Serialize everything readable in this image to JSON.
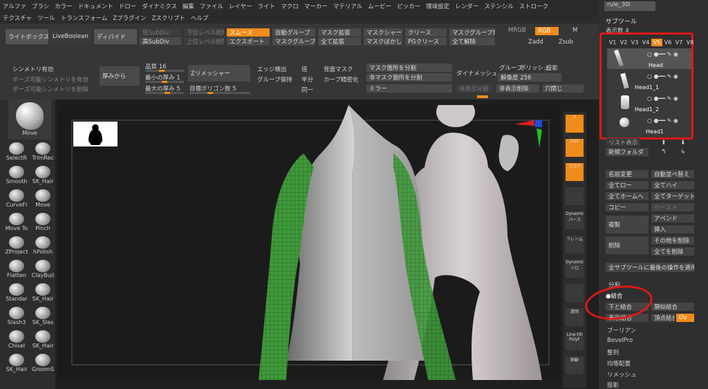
{
  "menu": [
    "アルファ",
    "ブラシ",
    "カラー",
    "ドキュメント",
    "ドロー",
    "ダイナミクス",
    "編集",
    "ファイル",
    "レイヤー",
    "ライト",
    "マクロ",
    "マーカー",
    "マテリアル",
    "ムービー",
    "ピッカー",
    "環境設定",
    "レンダー",
    "ステンシル",
    "ストローク"
  ],
  "menu2": [
    "テクスチャ",
    "ツール",
    "トランスフォーム",
    "Zプラグイン",
    "Zスクリプト",
    "ヘルプ"
  ],
  "palette": {
    "lightbox": "ライトボックス",
    "liveboolean": "LiveBoolean",
    "divide": "ディバイド",
    "delsubdiv": "低SubDiv",
    "highsubdiv": "高SubDiv",
    "lower_level": "下位レベル削除",
    "upper_level": "上位レベル削除",
    "smooth": "スムーズ",
    "export": "エクスポート",
    "auto_group": "自動グループ",
    "mask_group": "マスクグループ化",
    "mask_expand": "マスク拡張",
    "all_expand": "全て拡張",
    "mask_sharpen": "マスクシャープン",
    "mask_blur": "マスクぼかし",
    "crease": "クリース",
    "pgcrease": "PGクリース",
    "mask_group2": "マスクグループ化",
    "all_release": "全て解除",
    "mrgb": "MRGB",
    "rgb": "RGB",
    "m": "M",
    "zadd": "Zadd",
    "zsub": "Zsub",
    "symmetry": "シンメトリ有効",
    "pose_sym1": "ポーズ可能シンメトリを有効",
    "pose_sym2": "ポーズ可能シンメトリを削除",
    "thickness": "厚みから",
    "quality": "品質 16",
    "min_thick": "最小の厚み 1",
    "max_thick": "最大の厚み 5",
    "zremesher": "Zリメッシャー",
    "target_poly": "目標ポリゴン数 5",
    "edge_detect": "エッジ検出",
    "group_keep": "グループ保持",
    "double": "倍",
    "half": "半分",
    "same": "同一",
    "backface_mask": "背面マスク",
    "curve_refine": "カーブ精密化",
    "mask_split": "マスク箇所を分割",
    "unmask_split": "非マスク箇所を分割",
    "mirror": "ミラー",
    "dynamesh": "ダイナメッシュ",
    "group": "グループ",
    "polish": "ポリッシュ",
    "project": "投影",
    "resolution": "解像度 256",
    "hidden_split": "非表示分割",
    "hidden_delete": "非表示削除",
    "close_holes": "穴閉じ"
  },
  "brushes": {
    "main": "Move",
    "items": [
      "SelectR",
      "TrimRec",
      "Smooth",
      "SK_Hair",
      "CurveFl",
      "Move",
      "Move To",
      "Pinch",
      "ZProject",
      "hPolish",
      "Flatten",
      "ClayBuil",
      "Standar",
      "SK_Hair",
      "Slash3",
      "SK_Slas",
      "Chisel",
      "SK_Hair",
      "SK_Hair",
      "GroomS"
    ]
  },
  "right_shelf": [
    "S",
    "Edit",
    "ブロア",
    "",
    "Dynamic パース",
    "フレーム",
    "Dynamic ソロ",
    "",
    "透明",
    "Line Fill PolyF",
    "移動"
  ],
  "rightpanel": {
    "field": "rule_30i",
    "title": "サブツール",
    "display_count": "表示数 4",
    "versions": [
      "V1",
      "V2",
      "V3",
      "V4",
      "V5",
      "V6",
      "V7",
      "V8"
    ],
    "active_version": "V5",
    "subtools": [
      "Head",
      "Head1_1",
      "Head1_2",
      "Head1"
    ],
    "list_display": "リスト表示",
    "new_folder": "新規フォルダ",
    "rename": "名前変更",
    "auto_rename": "自動並べ替え",
    "all_low": "全てロー",
    "all_high": "全てハイ",
    "all_home": "全てホームへ",
    "all_target": "全てターゲットへ",
    "copy": "コピー",
    "paste": "ペースト",
    "duplicate": "複製",
    "append": "アペンド",
    "insert": "挿入",
    "delete": "削除",
    "delete_others": "その他を削除",
    "delete_all": "全てを削除",
    "apply_all": "全サブツールに最後の操作を適用",
    "split": "分割",
    "merge": "結合",
    "merge_down": "下と結合",
    "merge_similar": "類似結合",
    "merge_visible": "表示結合",
    "merge_vertex": "頂点結合",
    "uv": "Uv",
    "boolean": "ブーリアン",
    "bevelpro": "BevelPro",
    "align": "整列",
    "distribute": "均等配置",
    "remesh": "リメッシュ",
    "project": "投影"
  },
  "colors": {
    "accent": "#f08c1a",
    "annotation": "#e01818",
    "green_mesh": "#3f9a3a"
  }
}
